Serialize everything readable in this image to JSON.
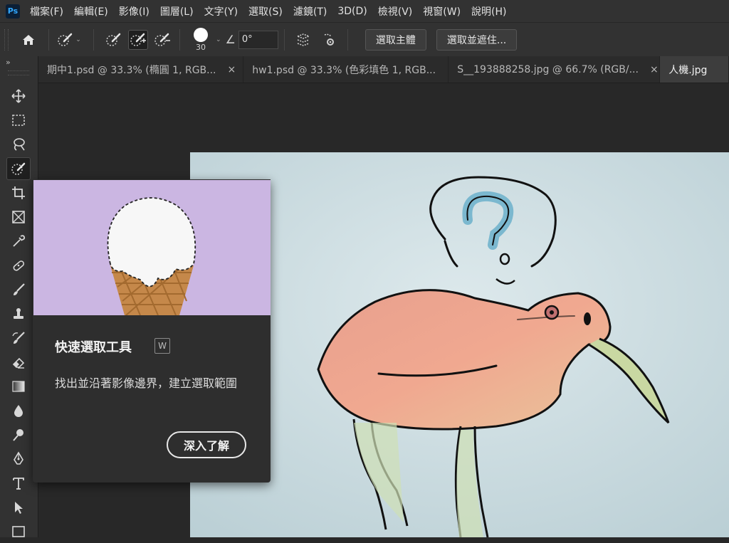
{
  "app": {
    "logo": "Ps"
  },
  "menu": [
    "檔案(F)",
    "編輯(E)",
    "影像(I)",
    "圖層(L)",
    "文字(Y)",
    "選取(S)",
    "濾鏡(T)",
    "3D(D)",
    "檢視(V)",
    "視窗(W)",
    "說明(H)"
  ],
  "options": {
    "brush_size": "30",
    "angle_value": "0°",
    "select_subject": "選取主體",
    "select_and_mask": "選取並遮住..."
  },
  "toolbar": {
    "collapse": "»"
  },
  "tabs": [
    {
      "label": "期中1.psd @ 33.3% (橢圓 1, RGB...",
      "close": "×"
    },
    {
      "label": "hw1.psd @ 33.3% (色彩填色 1, RGB...",
      "close": "×"
    },
    {
      "label": "S__193888258.jpg @ 66.7% (RGB/...",
      "close": "×"
    },
    {
      "label": "人機.jpg",
      "close": ""
    }
  ],
  "tooltip": {
    "title": "快速選取工具",
    "shortcut": "W",
    "description": "找出並沿著影像邊界，建立選取範圍",
    "learn_more": "深入了解"
  },
  "colors": {
    "accent": "#31a8ff",
    "chrome": "#323232",
    "canvas_bg": "#282828",
    "tooltip_image_bg": "#cbb6e2"
  }
}
